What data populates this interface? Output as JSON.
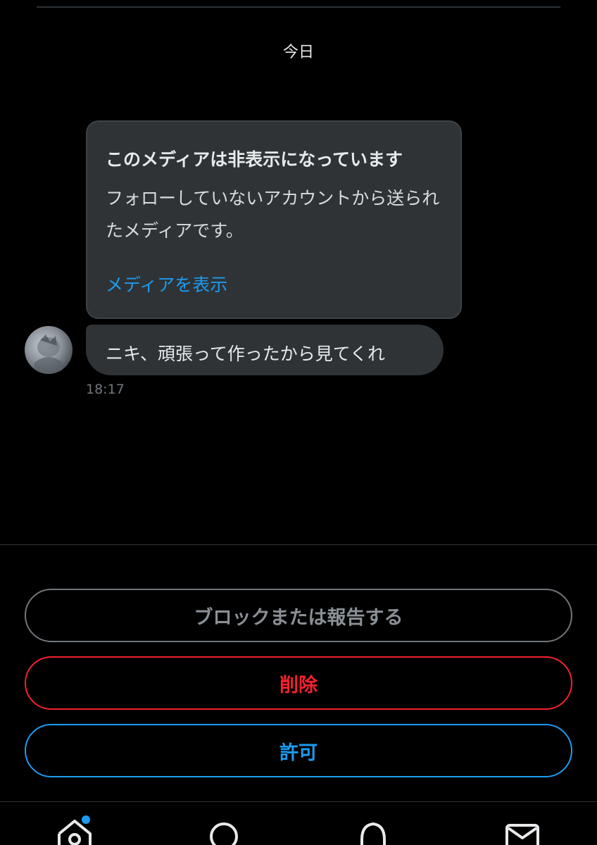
{
  "conversation": {
    "date_label": "今日",
    "media_notice": {
      "title": "このメディアは非表示になっています",
      "body": "フォローしていないアカウントから送られたメディアです。",
      "show_media_label": "メディアを表示"
    },
    "message": {
      "text": "ニキ、頑張って作ったから見てくれ",
      "time": "18:17"
    }
  },
  "actions": {
    "block_report_label": "ブロックまたは報告する",
    "delete_label": "削除",
    "accept_label": "許可"
  },
  "tabbar": {
    "icons": [
      "home-icon",
      "search-icon",
      "notifications-icon",
      "messages-icon"
    ],
    "home_has_notification": true
  },
  "colors": {
    "background": "#000000",
    "bubble": "#2f3336",
    "accent_blue": "#1d9bf0",
    "danger_red": "#f4212e",
    "muted_gray": "#71767b"
  }
}
